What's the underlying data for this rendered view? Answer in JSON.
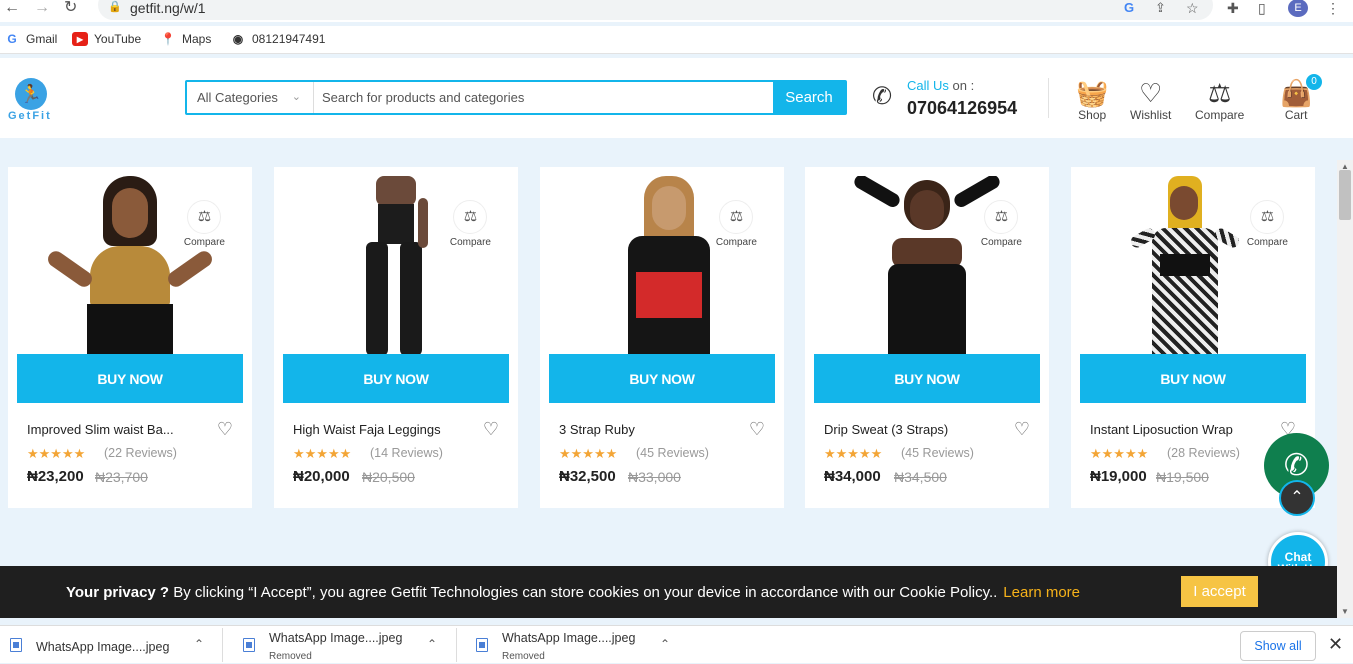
{
  "browser": {
    "url": "getfit.ng/w/1",
    "profile_initial": "E",
    "bookmarks": [
      "Gmail",
      "YouTube",
      "Maps",
      "08121947491"
    ]
  },
  "header": {
    "logo_text": "GetFit",
    "category_select": "All Categories",
    "search_placeholder": "Search for products and categories",
    "search_button": "Search",
    "call_label": "Call Us",
    "call_on": " on :",
    "call_number": "07064126954",
    "nav": {
      "shop": "Shop",
      "wishlist": "Wishlist",
      "compare": "Compare",
      "cart": "Cart",
      "cart_count": "0"
    }
  },
  "products": [
    {
      "name": "Improved Slim waist Ba...",
      "reviews": "(22 Reviews)",
      "price": "₦23,200",
      "old_price": "₦23,700",
      "buy": "BUY NOW",
      "compare": "Compare"
    },
    {
      "name": "High Waist Faja Leggings",
      "reviews": "(14 Reviews)",
      "price": "₦20,000",
      "old_price": "₦20,500",
      "buy": "BUY NOW",
      "compare": "Compare"
    },
    {
      "name": "3 Strap Ruby",
      "reviews": "(45 Reviews)",
      "price": "₦32,500",
      "old_price": "₦33,000",
      "buy": "BUY NOW",
      "compare": "Compare"
    },
    {
      "name": "Drip Sweat (3 Straps)",
      "reviews": "(45 Reviews)",
      "price": "₦34,000",
      "old_price": "₦34,500",
      "buy": "BUY NOW",
      "compare": "Compare"
    },
    {
      "name": "Instant Liposuction Wrap",
      "reviews": "(28 Reviews)",
      "price": "₦19,000",
      "old_price": "₦19,500",
      "buy": "BUY NOW",
      "compare": "Compare"
    }
  ],
  "widgets": {
    "chat_line1": "Chat",
    "chat_line2": "With Us"
  },
  "cookie": {
    "bold": "Your privacy ?",
    "text": " By clicking “I Accept”, you agree Getfit Technologies can store cookies on your device in accordance with our Cookie Policy..",
    "learn_more": "Learn more",
    "accept": "I accept"
  },
  "downloads": {
    "items": [
      {
        "name": "WhatsApp Image....jpeg",
        "status": ""
      },
      {
        "name": "WhatsApp Image....jpeg",
        "status": "Removed"
      },
      {
        "name": "WhatsApp Image....jpeg",
        "status": "Removed"
      }
    ],
    "show_all": "Show all"
  },
  "colors": {
    "accent": "#13b5ea",
    "star": "#f3a536",
    "accept": "#f6c444"
  }
}
